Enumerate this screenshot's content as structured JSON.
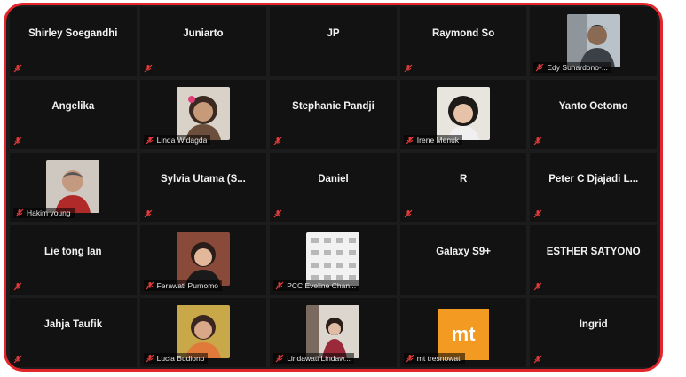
{
  "meeting": {
    "tiles": [
      {
        "name": "Shirley Soegandhi",
        "video": false
      },
      {
        "name": "Juniarto",
        "video": false
      },
      {
        "name": "JP",
        "video": false
      },
      {
        "name": "Raymond So",
        "video": false
      },
      {
        "name": "Edy Suhardono-...",
        "video": true
      },
      {
        "name": "Angelika",
        "video": false
      },
      {
        "name": "Linda Widagda",
        "video": true
      },
      {
        "name": "Stephanie Pandji",
        "video": false
      },
      {
        "name": "Irene Menuk",
        "video": true
      },
      {
        "name": "Yanto Oetomo",
        "video": false
      },
      {
        "name": "Hakim young",
        "video": true
      },
      {
        "name": "Sylvia Utama (S...",
        "video": false
      },
      {
        "name": "Daniel",
        "video": false
      },
      {
        "name": "R",
        "video": false
      },
      {
        "name": "Peter C Djajadi L...",
        "video": false
      },
      {
        "name": "Lie tong lan",
        "video": false
      },
      {
        "name": "Ferawati Purnomo",
        "video": true
      },
      {
        "name": "PCC Eveline Chan...",
        "video": true
      },
      {
        "name": "Galaxy S9+",
        "video": false
      },
      {
        "name": "ESTHER SATYONO",
        "video": false
      },
      {
        "name": "Jahja Taufik",
        "video": false
      },
      {
        "name": "Lucia Budiono",
        "video": true
      },
      {
        "name": "Lindawati Lindaw...",
        "video": true
      },
      {
        "name": "mt tresnowati",
        "video": true,
        "avatar_text": "mt"
      },
      {
        "name": "Ingrid",
        "video": false
      }
    ],
    "colors": {
      "frame_border": "#e3262b",
      "tile_bg": "#121212",
      "mute_red": "#e23b3b",
      "mt_avatar": "#f29a21"
    },
    "icons": {
      "muted": "microphone-muted-icon"
    }
  }
}
